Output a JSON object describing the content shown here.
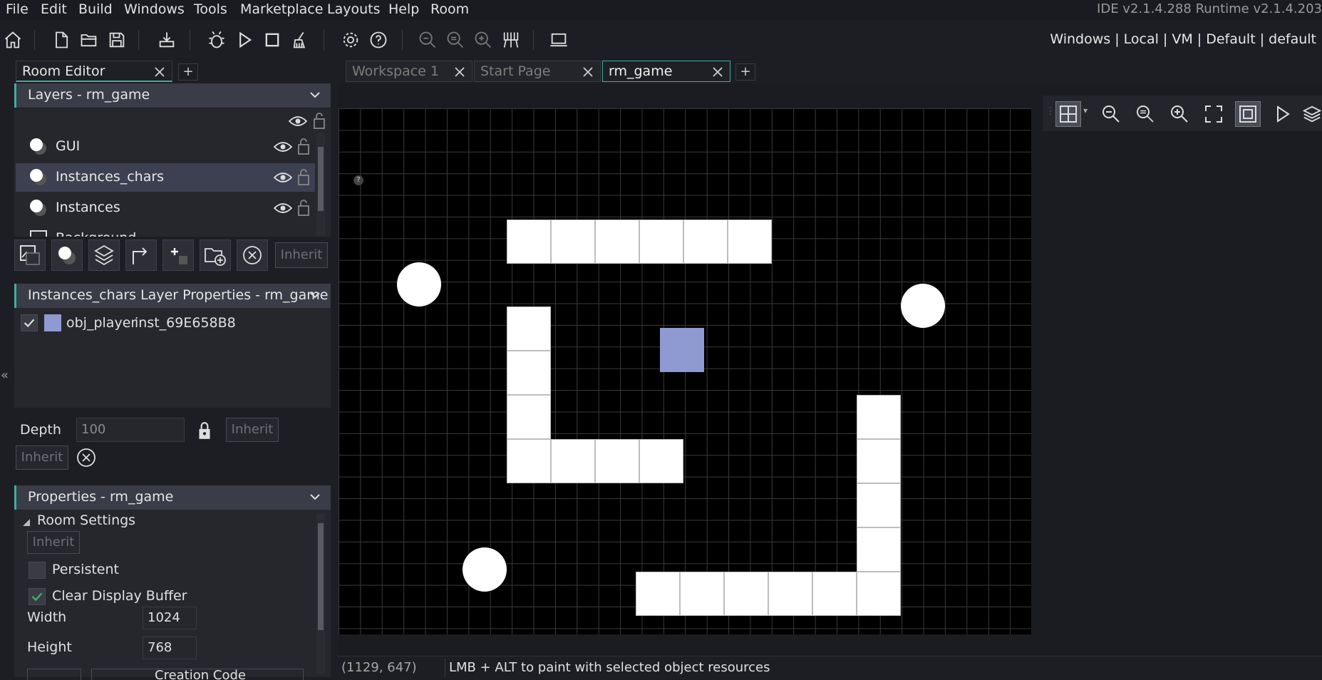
{
  "menu": [
    "File",
    "Edit",
    "Build",
    "Windows",
    "Tools",
    "Marketplace",
    "Layouts",
    "Help",
    "Room"
  ],
  "version": "IDE v2.1.4.288 Runtime v2.1.4.203",
  "target": "Windows | Local | VM | Default | default",
  "toolbar_icons": [
    "home-icon",
    "new-file-icon",
    "open-folder-icon",
    "save-icon",
    "create-executable-icon",
    "debug-icon",
    "run-icon",
    "stop-icon",
    "clean-icon",
    "settings-icon",
    "help-icon",
    "zoom-out-icon",
    "zoom-reset-icon",
    "zoom-in-icon",
    "deploy-icon",
    "device-icon"
  ],
  "left_panel": {
    "tab_title": "Room Editor",
    "add_tab": "+",
    "layers_header": "Layers - rm_game",
    "layers": [
      {
        "name": "GUI",
        "icon": "instance-layer-icon"
      },
      {
        "name": "Instances_chars",
        "icon": "instance-layer-icon",
        "selected": true
      },
      {
        "name": "Instances",
        "icon": "instance-layer-icon"
      },
      {
        "name": "Background",
        "icon": "background-layer-icon"
      }
    ],
    "layer_buttons": [
      "add-background-layer-icon",
      "add-instance-layer-icon",
      "add-tile-layer-icon",
      "add-path-layer-icon",
      "add-asset-layer-icon",
      "add-folder-icon",
      "delete-layer-icon"
    ],
    "inherit_label": "Inherit",
    "layer_props_header": "Instances_chars Layer Properties - rm_game",
    "instances": [
      {
        "object": "obj_player",
        "id": "inst_69E658B8",
        "checked": true,
        "color": "#8e9ad1"
      }
    ],
    "depth_label": "Depth",
    "depth_value": "100",
    "props_header": "Properties - rm_game",
    "room_settings_label": "Room Settings",
    "persistent_label": "Persistent",
    "persistent_checked": false,
    "clear_display_label": "Clear Display Buffer",
    "clear_display_checked": true,
    "width_label": "Width",
    "width_value": "1024",
    "height_label": "Height",
    "height_value": "768",
    "creation_code_label": "Creation Code"
  },
  "doc_tabs": [
    {
      "title": "Workspace 1",
      "active": false
    },
    {
      "title": "Start Page",
      "active": false
    },
    {
      "title": "rm_game",
      "active": true
    }
  ],
  "doc_add_tab": "+",
  "room_tools": [
    "grid-toggle-icon",
    "zoom-out-icon",
    "zoom-reset-icon",
    "zoom-in-icon",
    "fit-screen-icon",
    "frame-icon",
    "play-icon",
    "layers-icon"
  ],
  "status": {
    "coords": "(1129, 647)",
    "hint": "LMB + ALT to paint with selected object resources"
  },
  "colors": {
    "accent": "#3fae9e",
    "player": "#8e9ad1",
    "selected_row": "#3d4050"
  }
}
